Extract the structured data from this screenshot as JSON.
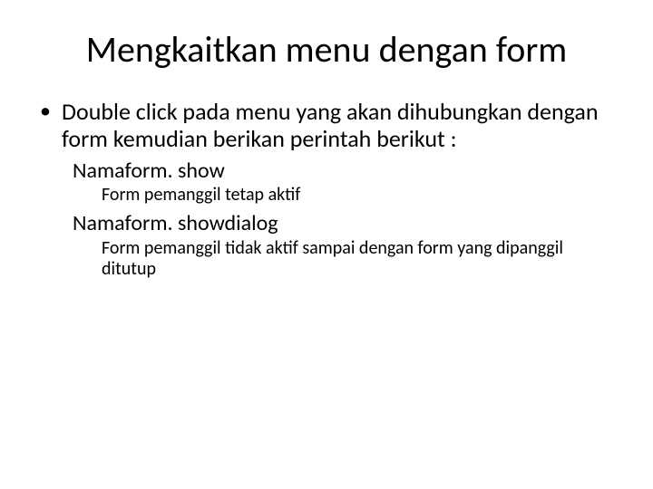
{
  "title": "Mengkaitkan menu dengan form",
  "bullet1": "Double click pada menu yang akan dihubungkan dengan form kemudian berikan perintah berikut :",
  "cmd1": "Namaform. show",
  "cmd1_desc": "Form pemanggil tetap aktif",
  "cmd2": "Namaform. showdialog",
  "cmd2_desc": "Form pemanggil tidak aktif sampai dengan form yang dipanggil ditutup"
}
